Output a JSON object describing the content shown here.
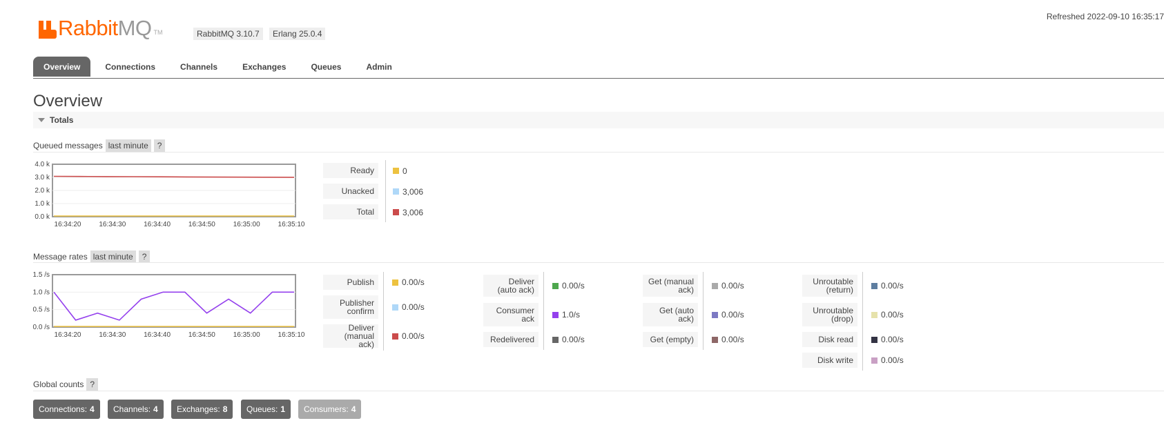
{
  "header": {
    "logo_main": "Rabbit",
    "logo_suffix": "MQ",
    "logo_tm": "TM",
    "version": "RabbitMQ 3.10.7",
    "erlang": "Erlang 25.0.4",
    "refreshed": "Refreshed 2022-09-10 16:35:17"
  },
  "tabs": [
    {
      "label": "Overview",
      "active": true
    },
    {
      "label": "Connections"
    },
    {
      "label": "Channels"
    },
    {
      "label": "Exchanges"
    },
    {
      "label": "Queues"
    },
    {
      "label": "Admin"
    }
  ],
  "page_title": "Overview",
  "section": {
    "label": "Totals"
  },
  "queued": {
    "label": "Queued messages",
    "range": "last minute",
    "help": "?",
    "legend": [
      {
        "label": "Ready",
        "value": "0",
        "color": "#edc240"
      },
      {
        "label": "Unacked",
        "value": "3,006",
        "color": "#afd8f8"
      },
      {
        "label": "Total",
        "value": "3,006",
        "color": "#cb4b4b"
      }
    ]
  },
  "rates": {
    "label": "Message rates",
    "range": "last minute",
    "help": "?",
    "col1": [
      {
        "label": "Publish",
        "value": "0.00/s",
        "color": "#edc240"
      },
      {
        "label": "Publisher confirm",
        "value": "0.00/s",
        "color": "#afd8f8"
      },
      {
        "label": "Deliver (manual ack)",
        "value": "0.00/s",
        "color": "#cb4b4b"
      }
    ],
    "col2": [
      {
        "label": "Deliver (auto ack)",
        "value": "0.00/s",
        "color": "#4da74d"
      },
      {
        "label": "Consumer ack",
        "value": "1.0/s",
        "color": "#9440ed"
      },
      {
        "label": "Redelivered",
        "value": "0.00/s",
        "color": "#666666"
      }
    ],
    "col3": [
      {
        "label": "Get (manual ack)",
        "value": "0.00/s",
        "color": "#aaaaaa"
      },
      {
        "label": "Get (auto ack)",
        "value": "0.00/s",
        "color": "#7c79c3"
      },
      {
        "label": "Get (empty)",
        "value": "0.00/s",
        "color": "#8e6767"
      }
    ],
    "col4": [
      {
        "label": "Unroutable (return)",
        "value": "0.00/s",
        "color": "#5e7ea0"
      },
      {
        "label": "Unroutable (drop)",
        "value": "0.00/s",
        "color": "#e6e2ab"
      },
      {
        "label": "Disk read",
        "value": "0.00/s",
        "color": "#333344"
      },
      {
        "label": "Disk write",
        "value": "0.00/s",
        "color": "#c9a0c4"
      }
    ]
  },
  "global": {
    "label": "Global counts",
    "help": "?",
    "buttons": [
      {
        "label": "Connections:",
        "count": "4"
      },
      {
        "label": "Channels:",
        "count": "4"
      },
      {
        "label": "Exchanges:",
        "count": "8"
      },
      {
        "label": "Queues:",
        "count": "1"
      },
      {
        "label": "Consumers:",
        "count": "4"
      }
    ]
  },
  "chart_data": [
    {
      "type": "line",
      "x": [
        "16:34:20",
        "16:34:30",
        "16:34:40",
        "16:34:50",
        "16:35:00",
        "16:35:10"
      ],
      "ylim": [
        0,
        4000
      ],
      "yticks": [
        "0.0 k",
        "1.0 k",
        "2.0 k",
        "3.0 k",
        "4.0 k"
      ],
      "series": [
        {
          "name": "Total",
          "color": "#cb4b4b",
          "values": [
            3080,
            3070,
            3060,
            3050,
            3040,
            3030,
            3020,
            3015,
            3010,
            3006
          ]
        },
        {
          "name": "Ready",
          "color": "#edc240",
          "values": [
            0,
            0,
            0,
            0,
            0,
            0,
            0,
            0,
            0,
            0
          ]
        }
      ]
    },
    {
      "type": "line",
      "x": [
        "16:34:20",
        "16:34:30",
        "16:34:40",
        "16:34:50",
        "16:35:00",
        "16:35:10"
      ],
      "ylim": [
        0,
        1.5
      ],
      "yticks": [
        "0.0 /s",
        "0.5 /s",
        "1.0 /s",
        "1.5 /s"
      ],
      "series": [
        {
          "name": "Consumer ack",
          "color": "#9440ed",
          "values": [
            1.0,
            0.2,
            0.4,
            0.2,
            0.8,
            1.0,
            1.0,
            0.4,
            0.8,
            0.4,
            1.0,
            1.0
          ]
        },
        {
          "name": "Publish",
          "color": "#edc240",
          "values": [
            0,
            0,
            0,
            0,
            0,
            0,
            0,
            0,
            0,
            0,
            0,
            0
          ]
        }
      ]
    }
  ]
}
